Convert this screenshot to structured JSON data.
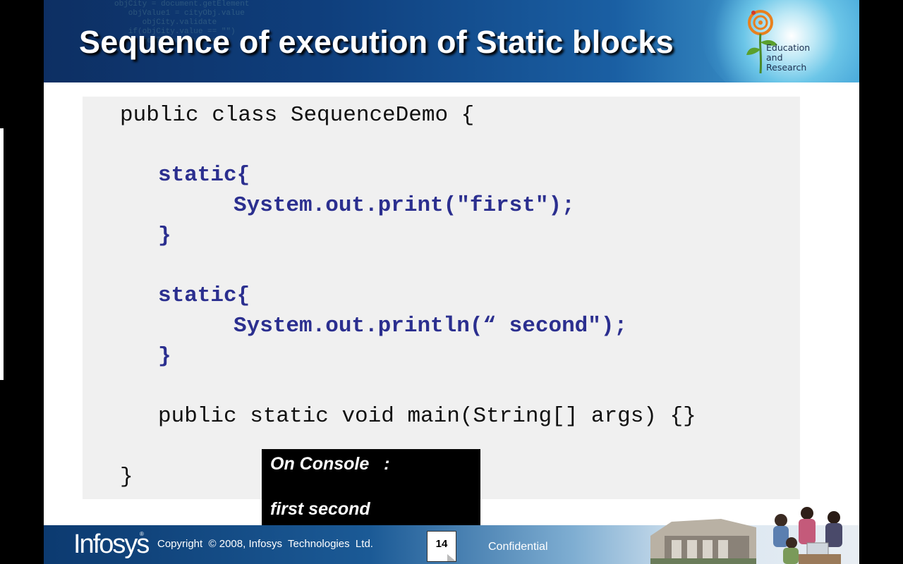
{
  "slide": {
    "title": "Sequence of execution of Static blocks",
    "logo": {
      "line1": "Education",
      "line2": "and",
      "line3": "Research"
    },
    "header_code_watermark": "objCity = document.getElement\n   objValue1 = cityObj.value\n      objCity.validate\n   if(objCity.value == \"\")\n      getElementByName"
  },
  "code": {
    "lines": [
      "public class SequenceDemo {",
      "static{",
      "System.out.print(\"first\");",
      "}",
      "static{",
      "System.out.println(“ second\");",
      "}",
      "public static void main(String[] args) {}",
      "}"
    ]
  },
  "console": {
    "label": "On Console   :",
    "output": "first second"
  },
  "footer": {
    "company_logo": "Infosys",
    "registered": "®",
    "copyright": "Copyright  © 2008, Infosys  Technologies  Ltd.",
    "page_number": "14",
    "confidential": "Confidential"
  },
  "colors": {
    "keyword": "#2b2f8f",
    "code_background": "#f0f0f0",
    "header_dark": "#0d2f63",
    "header_light": "#4fb0de"
  }
}
